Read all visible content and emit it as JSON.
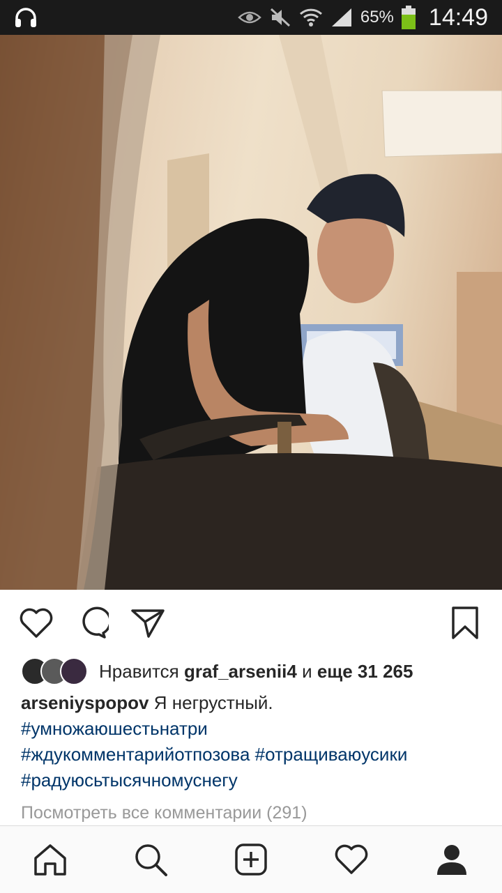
{
  "status_bar": {
    "battery_percent": "65%",
    "time": "14:49",
    "icons": [
      "headphones-icon",
      "eye-icon",
      "mute-icon",
      "wifi-icon",
      "signal-icon",
      "battery-icon"
    ]
  },
  "post": {
    "photo_alt": "",
    "likes": {
      "prefix": "Нравится",
      "user": "graf_arsenii4",
      "conjunction": "и",
      "others": "еще 31 265"
    },
    "caption": {
      "author": "arseniyspopov",
      "text": "Я негрустный.",
      "hashtags": [
        "#умножаюшестьнатри",
        "#ждукомментарийотпозова",
        "#отращиваюусики",
        "#радуюсьтысячномуснегу"
      ]
    },
    "view_comments": "Посмотреть все комментарии (291)"
  },
  "colors": {
    "text": "#262626",
    "hashtag": "#003569",
    "muted": "#999999",
    "statusbar": "#1a1a1a",
    "battery": "#7cc018"
  }
}
